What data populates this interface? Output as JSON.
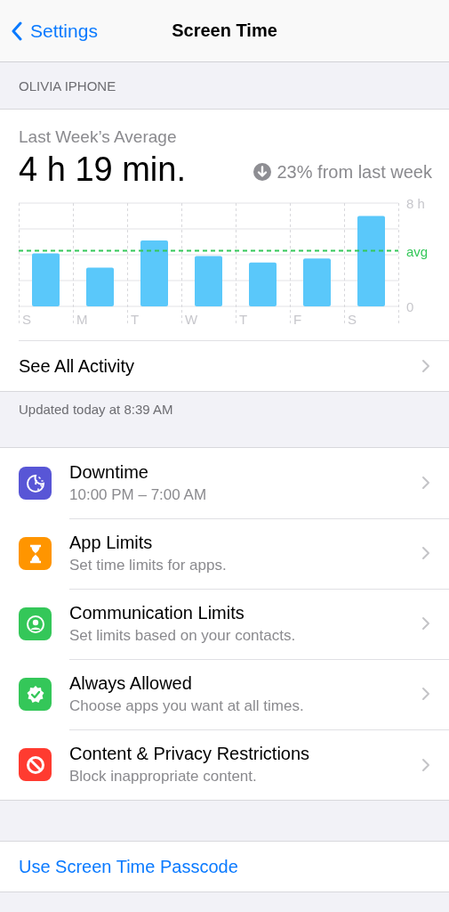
{
  "nav": {
    "back_label": "Settings",
    "title": "Screen Time"
  },
  "device_header": "OLIVIA IPHONE",
  "summary": {
    "label": "Last Week’s Average",
    "value": "4 h 19 min.",
    "change": "23% from last week",
    "chart_data": {
      "type": "bar",
      "categories": [
        "S",
        "M",
        "T",
        "W",
        "T",
        "F",
        "S"
      ],
      "series": [
        {
          "color": "#5ac8fa",
          "values": [
            4.1,
            3.0,
            5.1,
            3.9,
            3.4,
            3.7,
            7.0
          ]
        }
      ],
      "ylim": [
        0,
        8
      ],
      "yticks": [
        {
          "value": 0,
          "label": "0"
        },
        {
          "value": 8,
          "label": "8 h"
        }
      ],
      "ref_lines": [
        {
          "axis": "y",
          "value": 4.31,
          "label": "avg",
          "color": "#34c759"
        }
      ]
    }
  },
  "see_all": "See All Activity",
  "updated": "Updated today at 8:39 AM",
  "items": [
    {
      "kind": "downtime",
      "title": "Downtime",
      "subtitle": "10:00 PM – 7:00 AM",
      "color": "#5856d6"
    },
    {
      "kind": "applimits",
      "title": "App Limits",
      "subtitle": "Set time limits for apps.",
      "color": "#ff9500"
    },
    {
      "kind": "communication",
      "title": "Communication Limits",
      "subtitle": "Set limits based on your contacts.",
      "color": "#34c759"
    },
    {
      "kind": "allowed",
      "title": "Always Allowed",
      "subtitle": "Choose apps you want at all times.",
      "color": "#34c759"
    },
    {
      "kind": "restrictions",
      "title": "Content & Privacy Restrictions",
      "subtitle": "Block inappropriate content.",
      "color": "#ff3b30"
    }
  ],
  "passcode_link": "Use Screen Time Passcode"
}
